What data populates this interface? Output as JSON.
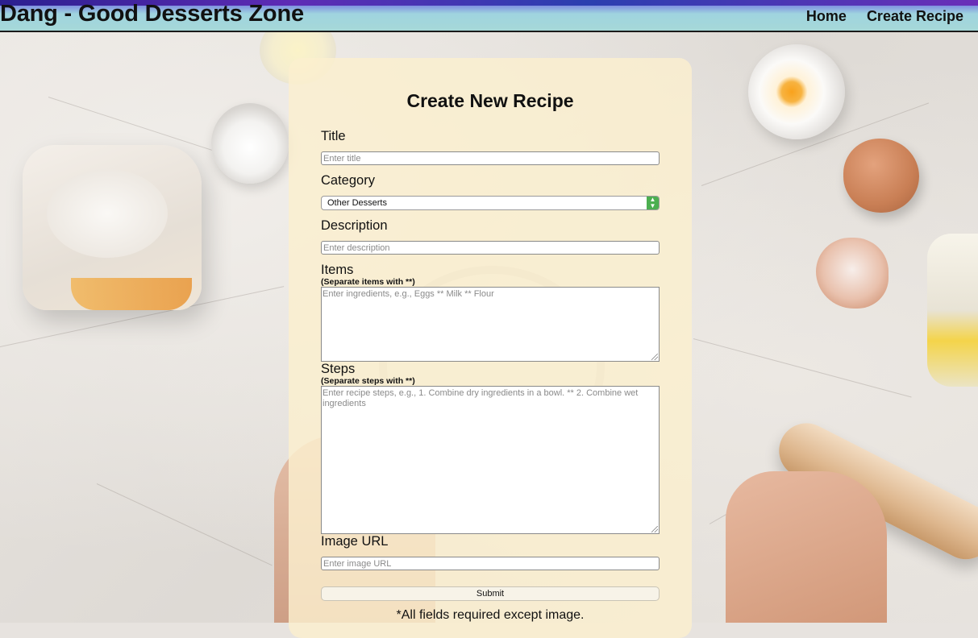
{
  "app": {
    "brand": "Dang - Good Desserts Zone",
    "nav": {
      "home": "Home",
      "create": "Create Recipe"
    }
  },
  "form": {
    "heading": "Create New Recipe",
    "title_label": "Title",
    "title_placeholder": "Enter title",
    "category_label": "Category",
    "category_selected": "Other Desserts",
    "description_label": "Description",
    "description_placeholder": "Enter description",
    "items_label": "Items",
    "items_hint": "(Separate items with **)",
    "items_placeholder": "Enter ingredients, e.g., Eggs ** Milk ** Flour",
    "steps_label": "Steps",
    "steps_hint": "(Separate steps with **)",
    "steps_placeholder": "Enter recipe steps, e.g., 1. Combine dry ingredients in a bowl. ** 2. Combine wet ingredients",
    "image_label": "Image URL",
    "image_placeholder": "Enter image URL",
    "submit_label": "Submit",
    "footnote": "*All fields required except image."
  },
  "colors": {
    "card_background": "#fbefce",
    "select_accent": "#4caf50"
  }
}
